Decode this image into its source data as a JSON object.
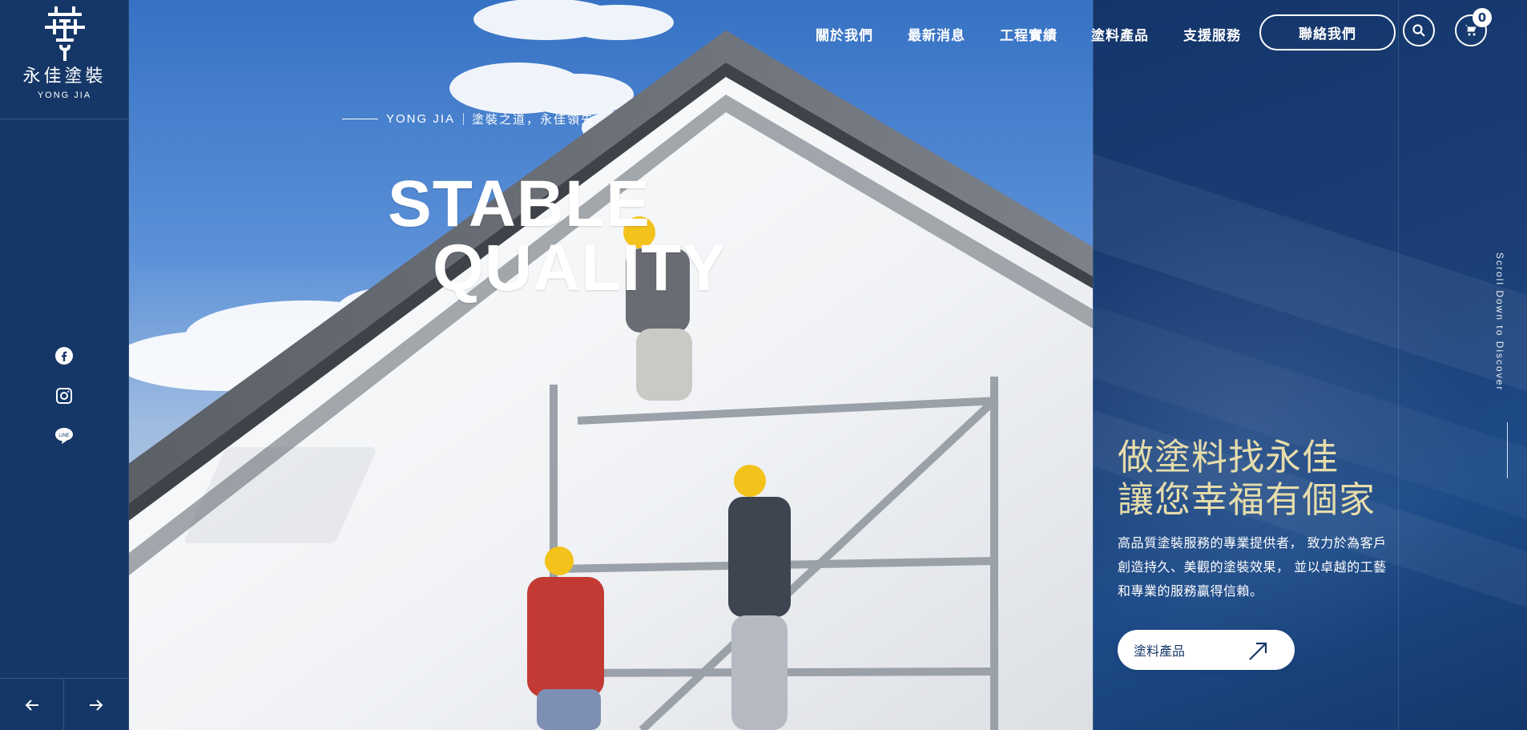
{
  "brand": {
    "name": "永佳塗裝",
    "sub": "YONG JIA"
  },
  "header": {
    "nav": [
      {
        "label": "關於我們"
      },
      {
        "label": "最新消息"
      },
      {
        "label": "工程實績"
      },
      {
        "label": "塗料產品"
      },
      {
        "label": "支援服務"
      }
    ],
    "contact_label": "聯絡我們",
    "cart_count": "0"
  },
  "hero": {
    "tagline_left": "YONG JIA",
    "tagline_right": "塗裝之道，永佳領先",
    "title_line_1": "STABLE",
    "title_line_2": "QUALITY"
  },
  "panel": {
    "heading_line_1": "做塗料找永佳",
    "heading_line_2": "讓您幸福有個家",
    "description": "高品質塗裝服務的專業提供者， 致力於為客戶創造持久、美觀的塗裝效果， 並以卓越的工藝和專業的服務贏得信賴。",
    "cta_label": "塗料產品"
  },
  "scroll": {
    "text": "Scroll Down to Discover"
  },
  "icons": {
    "facebook": "facebook-icon",
    "instagram": "instagram-icon",
    "line": "line-icon",
    "search": "search-icon",
    "cart": "cart-icon",
    "prev": "arrow-left-icon",
    "next": "arrow-right-icon",
    "cta": "arrow-up-right-icon"
  },
  "colors": {
    "navy": "#153767",
    "gold": "#e6dcaa",
    "white": "#ffffff"
  }
}
